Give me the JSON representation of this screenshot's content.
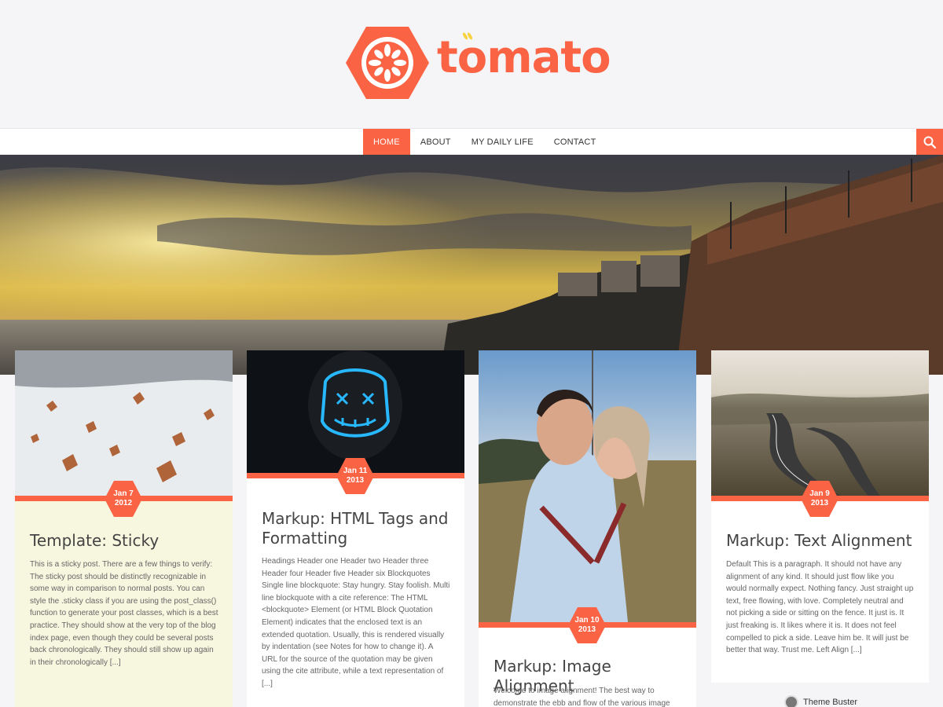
{
  "site": {
    "logo_text": "tomato"
  },
  "nav": {
    "items": [
      {
        "label": "HOME",
        "active": true
      },
      {
        "label": "ABOUT",
        "active": false
      },
      {
        "label": "MY DAILY LIFE",
        "active": false
      },
      {
        "label": "CONTACT",
        "active": false
      }
    ]
  },
  "colors": {
    "accent": "#fa6344",
    "sticky_bg": "#f7f6df"
  },
  "posts": [
    {
      "date_day": "Jan 7",
      "date_year": "2012",
      "title": "Template: Sticky",
      "excerpt": "This is a sticky post. There are a few things to verify: The sticky post should be distinctly recognizable in some way in comparison to normal posts. You can style the .sticky class if you are using the post_class() function to generate your post classes, which is a best practice. They should show at the very top of the blog index page, even though they could be several posts back chronologically. They should still show up again in their chronologically [...]"
    },
    {
      "date_day": "Jan 11",
      "date_year": "2013",
      "title": "Markup: HTML Tags and Formatting",
      "excerpt": "Headings Header one Header two Header three Header four Header five Header six Blockquotes Single line blockquote: Stay hungry. Stay foolish. Multi line blockquote with a cite reference: The HTML <blockquote> Element (or HTML Block Quotation Element) indicates that the enclosed text is an extended quotation. Usually, this is rendered visually by indentation (see Notes for how to change it). A URL for the source of the quotation may be given using the cite attribute, while a text representation of [...]"
    },
    {
      "date_day": "Jan 10",
      "date_year": "2013",
      "title": "Markup: Image Alignment",
      "excerpt": "Welcome to image alignment! The best way to demonstrate the ebb and flow of the various image"
    },
    {
      "date_day": "Jan 9",
      "date_year": "2013",
      "title": "Markup: Text Alignment",
      "excerpt": "Default This is a paragraph. It should not have any alignment of any kind. It should just flow like you would normally expect. Nothing fancy. Just straight up text, free flowing, with love. Completely neutral and not picking a side or sitting on the fence. It just is. It just freaking is. It likes where it is. It does not feel compelled to pick a side. Leave him be. It will just be better that way. Trust me. Left Align [...]"
    }
  ],
  "author": {
    "name": "Theme Buster"
  }
}
